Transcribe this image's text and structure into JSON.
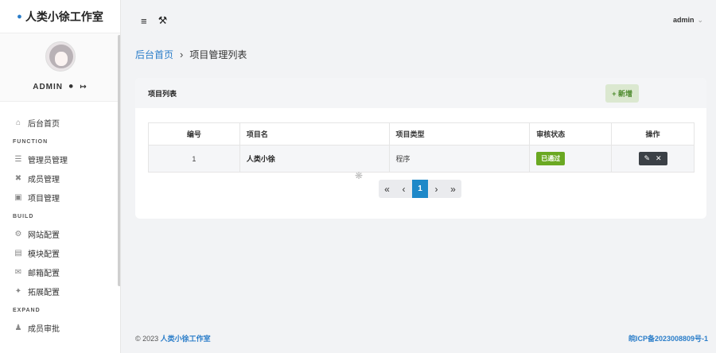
{
  "sidebar": {
    "brand": "人类小徐工作室",
    "profile": {
      "username": "ADMIN"
    },
    "items": [
      {
        "label": "后台首页",
        "icon": "home-icon"
      },
      {
        "section": "FUNCTION"
      },
      {
        "label": "管理员管理",
        "icon": "list-icon"
      },
      {
        "label": "成员管理",
        "icon": "tools-icon"
      },
      {
        "label": "项目管理",
        "icon": "database-icon"
      },
      {
        "section": "BUILD"
      },
      {
        "label": "网站配置",
        "icon": "cogs-icon"
      },
      {
        "label": "模块配置",
        "icon": "folder-icon"
      },
      {
        "label": "邮箱配置",
        "icon": "mail-icon"
      },
      {
        "section": "EXPAND"
      },
      {
        "label": "拓展配置",
        "icon": "plugin-icon"
      },
      {
        "label": "成员审批",
        "icon": "user-plus-icon"
      }
    ]
  },
  "header": {
    "user": "admin"
  },
  "breadcrumb": {
    "home": "后台首页",
    "current": "项目管理列表"
  },
  "card": {
    "title": "项目列表",
    "add_label": "+ 新增",
    "table": {
      "columns": [
        "编号",
        "项目名",
        "项目类型",
        "审核状态",
        "操作"
      ],
      "rows": [
        {
          "id": "1",
          "name": "人类小徐",
          "type": "程序",
          "status": "已通过"
        }
      ]
    }
  },
  "pagination": {
    "first": "«",
    "prev": "‹",
    "current": "1",
    "next": "›",
    "last": "»"
  },
  "footer": {
    "copyright": "© 2023",
    "brand": "人类小徐工作室",
    "icp": "皖ICP备2023008809号-1"
  },
  "colors": {
    "accent": "#1e88c8",
    "success": "#6aa822",
    "link": "#2a7dc9"
  }
}
